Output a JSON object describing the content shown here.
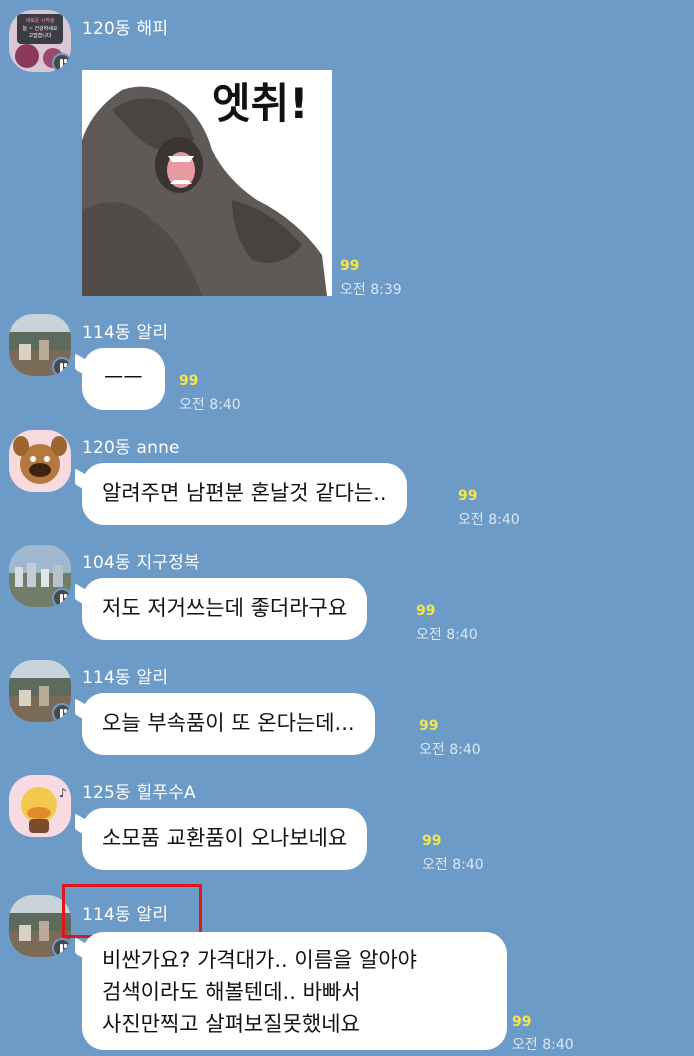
{
  "messages": [
    {
      "sender": "120동 해피",
      "kind": "sticker",
      "sticker_text": "엣취!",
      "unread": "99",
      "time": "오전 8:39"
    },
    {
      "sender": "114동 알리",
      "text": "ㅡㅡ",
      "unread": "99",
      "time": "오전 8:40"
    },
    {
      "sender": "120동 anne",
      "text": "알려주면 남편분 혼날것 같다는..",
      "unread": "99",
      "time": "오전 8:40"
    },
    {
      "sender": "104동 지구정복",
      "text": "저도 저거쓰는데 좋더라구요",
      "unread": "99",
      "time": "오전 8:40"
    },
    {
      "sender": "114동 알리",
      "text": "오늘 부속품이 또 온다는데...",
      "unread": "99",
      "time": "오전 8:40"
    },
    {
      "sender": "125동 힐푸수A",
      "text": "소모품 교환품이 오나보네요",
      "unread": "99",
      "time": "오전 8:40"
    },
    {
      "sender": "114동 알리",
      "lines": [
        "비싼가요?  가격대가..  이름을 알아야",
        "검색이라도 해볼텐데..  바빠서",
        "사진만찍고 살펴보질못했네요"
      ],
      "unread": "99",
      "time": "오전 8:40"
    }
  ],
  "avatar_texts": {
    "happy": [
      "새로운 시작을",
      "늘 ~ 건강하세요",
      "고맙습니다"
    ]
  },
  "colors": {
    "background": "#6d9bc8",
    "bubble": "#ffffff",
    "unread": "#f3e64b",
    "highlight": "#e0161b"
  }
}
